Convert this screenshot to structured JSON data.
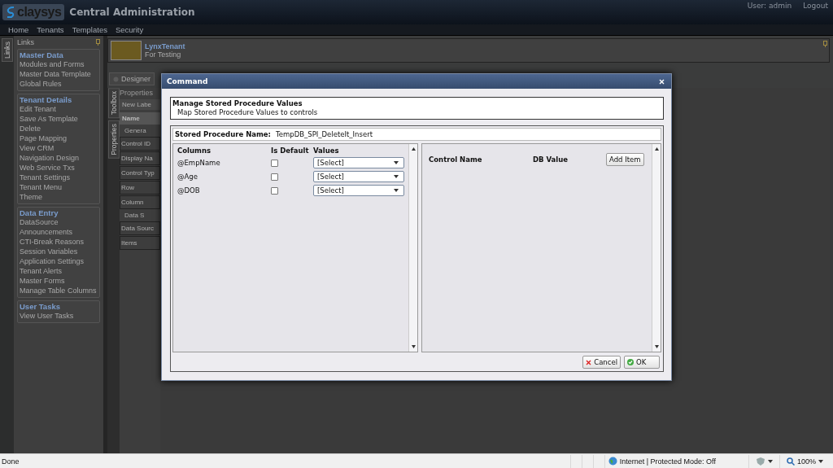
{
  "header": {
    "logo": "claysys",
    "title": "Central Administration",
    "user": "User: admin",
    "logout": "Logout"
  },
  "nav": [
    "Home",
    "Tenants",
    "Templates",
    "Security"
  ],
  "links_tab": "Links",
  "links_panel": {
    "title": "Links",
    "groups": [
      {
        "title": "Master Data",
        "items": [
          "Modules and Forms",
          "Master Data Template",
          "Global Rules"
        ]
      },
      {
        "title": "Tenant Details",
        "items": [
          "Edit Tenant",
          "Save As Template",
          "Delete",
          "Page Mapping",
          "View CRM",
          "Navigation Design",
          "Web Service Txs",
          "Tenant Settings",
          "Tenant Menu",
          "Theme"
        ]
      },
      {
        "title": "Data Entry",
        "items": [
          "DataSource",
          "Announcements",
          "CTI-Break Reasons",
          "Session Variables",
          "Application Settings",
          "Tenant Alerts",
          "Master Forms",
          "Manage Table Columns"
        ]
      },
      {
        "title": "User Tasks",
        "items": [
          "View User Tasks"
        ]
      }
    ]
  },
  "tenant": {
    "name": "LynxTenant",
    "description": "For Testing"
  },
  "designer_button": "Designer",
  "side_tabs": [
    "Toolbox",
    "Properties"
  ],
  "properties": {
    "title": "Properties",
    "new_label": "New Labe",
    "header": "Name",
    "sections": [
      {
        "title": "Genera",
        "rows": [
          "Control ID",
          "Display Na",
          "Control Typ",
          "Row",
          "Column"
        ]
      },
      {
        "title": "Data S",
        "rows": [
          "Data Sourc",
          "Items"
        ]
      }
    ]
  },
  "dialog": {
    "title": "Command",
    "heading": "Manage Stored Procedure Values",
    "subheading": "Map Stored Procedure Values to controls",
    "sp_label": "Stored Procedure Name:",
    "sp_value": "TempDB_SPI_DeleteIt_Insert",
    "columns_headers": [
      "Columns",
      "Is Default",
      "Values"
    ],
    "rows": [
      {
        "name": "@EmpName",
        "is_default": false,
        "value": "[Select]"
      },
      {
        "name": "@Age",
        "is_default": false,
        "value": "[Select]"
      },
      {
        "name": "@DOB",
        "is_default": false,
        "value": "[Select]"
      }
    ],
    "mapping_headers": [
      "Control Name",
      "DB Value"
    ],
    "add_item": "Add Item",
    "cancel": "Cancel",
    "ok": "OK"
  },
  "status_bar": {
    "text": "Done",
    "zone": "Internet | Protected Mode: Off",
    "zoom": "100%"
  }
}
